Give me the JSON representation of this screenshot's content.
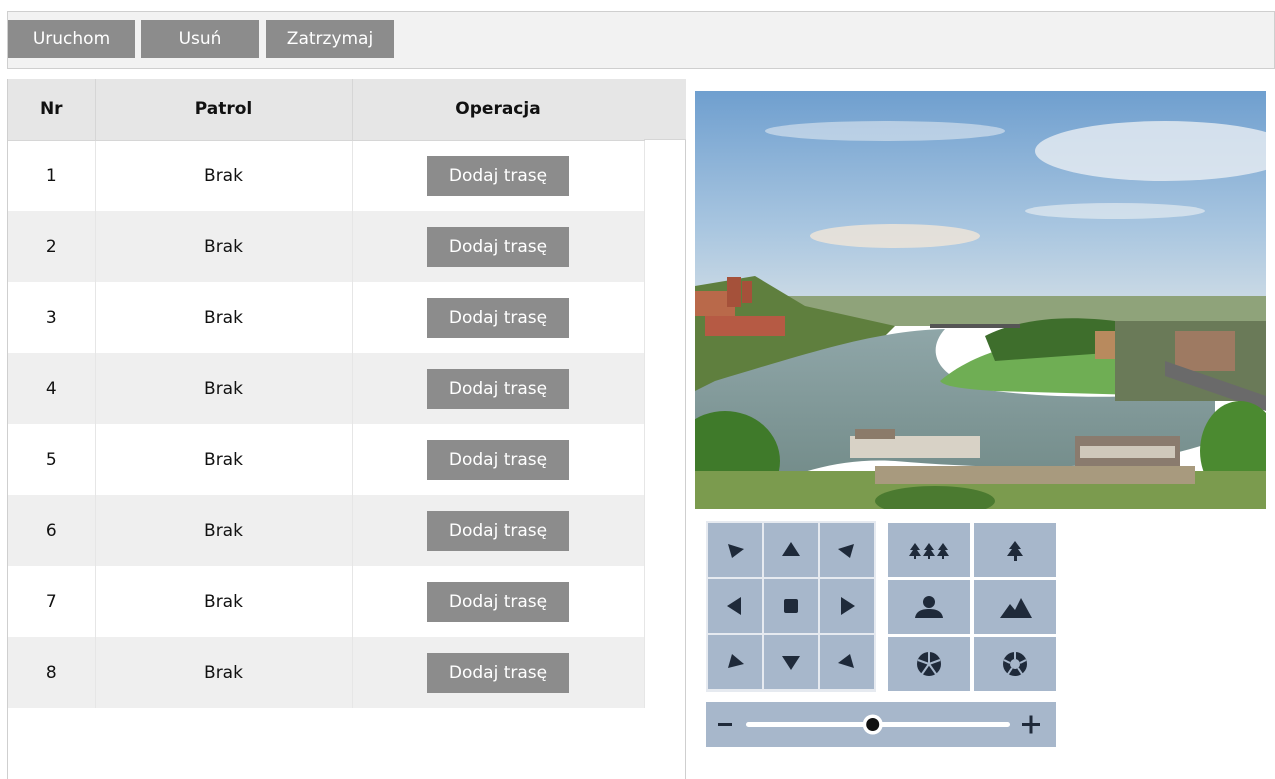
{
  "toolbar": {
    "start_label": "Uruchom",
    "delete_label": "Usuń",
    "stop_label": "Zatrzymaj"
  },
  "table": {
    "headers": {
      "nr": "Nr",
      "patrol": "Patrol",
      "operation": "Operacja"
    },
    "rows": [
      {
        "nr": "1",
        "patrol": "Brak",
        "action": "Dodaj trasę"
      },
      {
        "nr": "2",
        "patrol": "Brak",
        "action": "Dodaj trasę"
      },
      {
        "nr": "3",
        "patrol": "Brak",
        "action": "Dodaj trasę"
      },
      {
        "nr": "4",
        "patrol": "Brak",
        "action": "Dodaj trasę"
      },
      {
        "nr": "5",
        "patrol": "Brak",
        "action": "Dodaj trasę"
      },
      {
        "nr": "6",
        "patrol": "Brak",
        "action": "Dodaj trasę"
      },
      {
        "nr": "7",
        "patrol": "Brak",
        "action": "Dodaj trasę"
      },
      {
        "nr": "8",
        "patrol": "Brak",
        "action": "Dodaj trasę"
      }
    ]
  },
  "ptz": {
    "icons": {
      "up_left": "arrow-up-left-icon",
      "up": "arrow-up-icon",
      "up_right": "arrow-up-right-icon",
      "left": "arrow-left-icon",
      "stop": "stop-icon",
      "right": "arrow-right-icon",
      "down_left": "arrow-down-left-icon",
      "down": "arrow-down-icon",
      "down_right": "arrow-down-right-icon",
      "zoom_wide": "trees-wide-icon",
      "zoom_tele": "tree-tele-icon",
      "focus_near": "person-focus-icon",
      "focus_far": "mountain-focus-icon",
      "iris_close": "iris-close-icon",
      "iris_open": "iris-open-icon",
      "minus": "minus-icon",
      "plus": "plus-icon"
    },
    "speed_level": 0.48
  },
  "colors": {
    "toolbar_button": "#8c8c8c",
    "ptz_button": "#a7b7cb",
    "ptz_icon": "#1f2a3a"
  }
}
